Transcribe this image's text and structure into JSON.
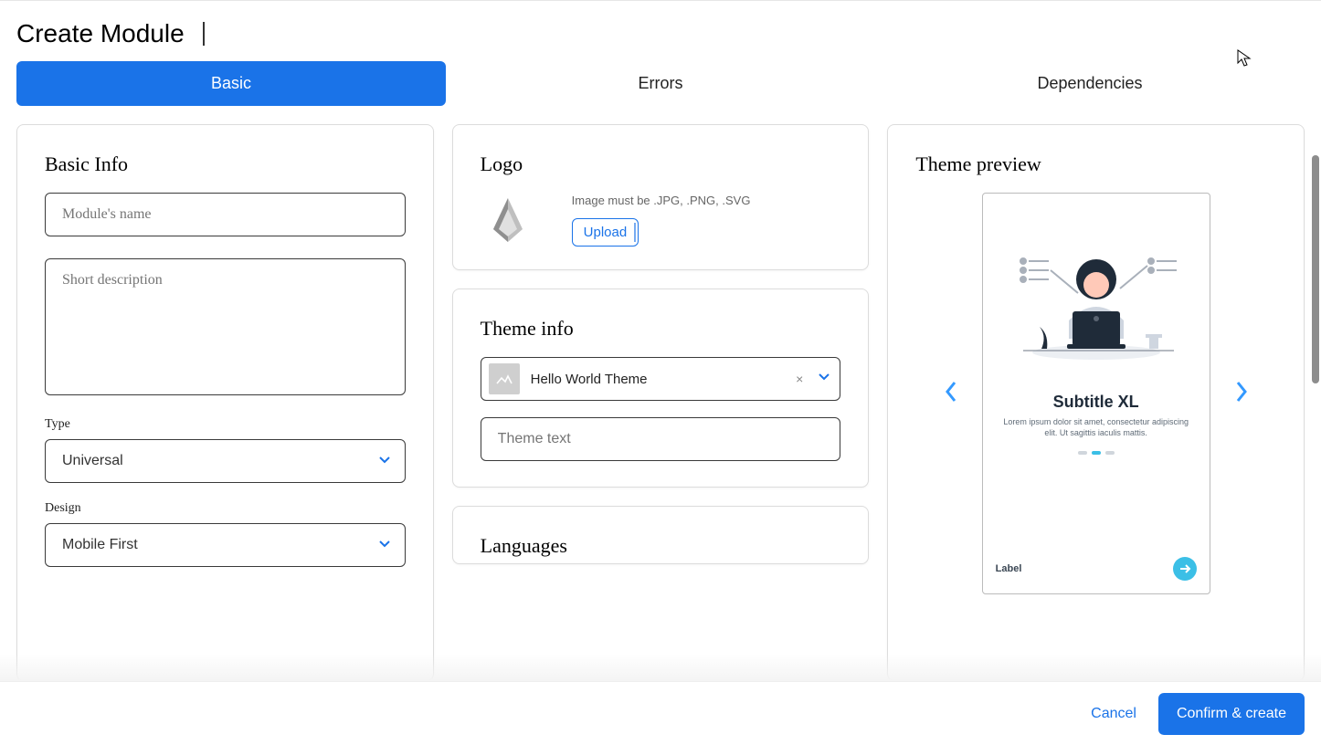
{
  "header": {
    "title": "Create Module"
  },
  "tabs": [
    {
      "label": "Basic",
      "active": true
    },
    {
      "label": "Errors",
      "active": false
    },
    {
      "label": "Dependencies",
      "active": false
    }
  ],
  "basic_info": {
    "title": "Basic Info",
    "name_placeholder": "Module's name",
    "name_value": "",
    "desc_placeholder": "Short description",
    "desc_value": "",
    "type_label": "Type",
    "type_value": "Universal",
    "design_label": "Design",
    "design_value": "Mobile First"
  },
  "logo": {
    "title": "Logo",
    "hint": "Image must be .JPG, .PNG, .SVG",
    "upload_label": "Upload"
  },
  "theme": {
    "title": "Theme info",
    "selected": "Hello World Theme",
    "clear_icon": "×",
    "text_placeholder": "Theme text",
    "text_value": ""
  },
  "languages": {
    "title": "Languages"
  },
  "preview": {
    "title": "Theme preview",
    "subtitle": "Subtitle XL",
    "lorem": "Lorem ipsum dolor sit amet, consectetur adipiscing elit. Ut sagittis iaculis mattis.",
    "label": "Label"
  },
  "footer": {
    "cancel": "Cancel",
    "confirm": "Confirm & create"
  }
}
